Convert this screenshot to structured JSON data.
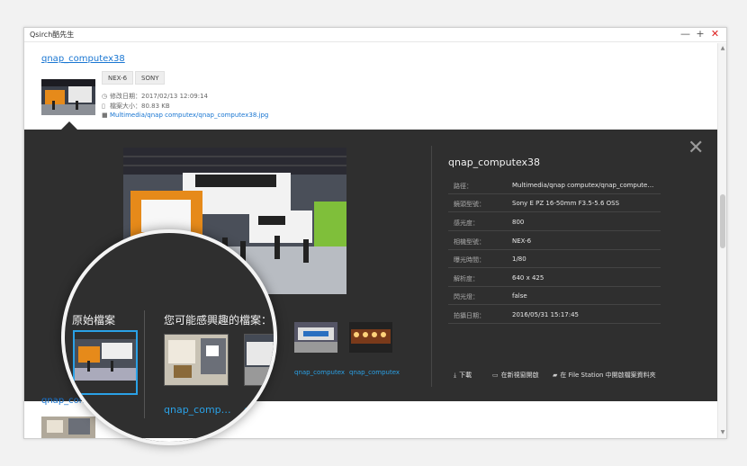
{
  "window": {
    "title": "Qsirch酷先生",
    "controls": {
      "minimize": "—",
      "maximize": "+",
      "close": "✕"
    }
  },
  "result": {
    "title": "qnap_computex38",
    "tags": [
      "NEX-6",
      "SONY"
    ],
    "modified": "修改日期：2017/02/13 12:09:14",
    "size": "檔案大小：80.83 KB",
    "path": "Multimedia/qnap computex/qnap_computex38.jpg"
  },
  "detail": {
    "title": "qnap_computex38",
    "rows": [
      {
        "k": "路徑：",
        "v": "Multimedia/qnap computex/qnap_compute…"
      },
      {
        "k": "鏡頭型號：",
        "v": "Sony E PZ 16-50mm F3.5-5.6 OSS"
      },
      {
        "k": "感光度：",
        "v": "800"
      },
      {
        "k": "相機型號：",
        "v": "NEX-6"
      },
      {
        "k": "曝光時間：",
        "v": "1/80"
      },
      {
        "k": "解析度：",
        "v": "640 x 425"
      },
      {
        "k": "閃光燈：",
        "v": "false"
      },
      {
        "k": "拍攝日期：",
        "v": "2016/05/31 15:17:45"
      }
    ],
    "actions": {
      "download": "下載",
      "open_new": "在新視窗開啟",
      "open_folder": "在 File Station 中開啟檔案資料夾"
    }
  },
  "similar": {
    "labels": [
      "qnap_computex",
      "qnap_computex"
    ]
  },
  "magnifier": {
    "original_heading": "原始檔案",
    "similar_heading": "您可能感興趣的檔案：",
    "original_label": "qnap_comp…",
    "similar_label": "qnap_comp…",
    "similar_label_2": "qn"
  },
  "next_result": {
    "title": "qnap_computex"
  },
  "colors": {
    "link": "#1976d2",
    "accent": "#2aa1e6",
    "panel": "#2f2f2f"
  }
}
